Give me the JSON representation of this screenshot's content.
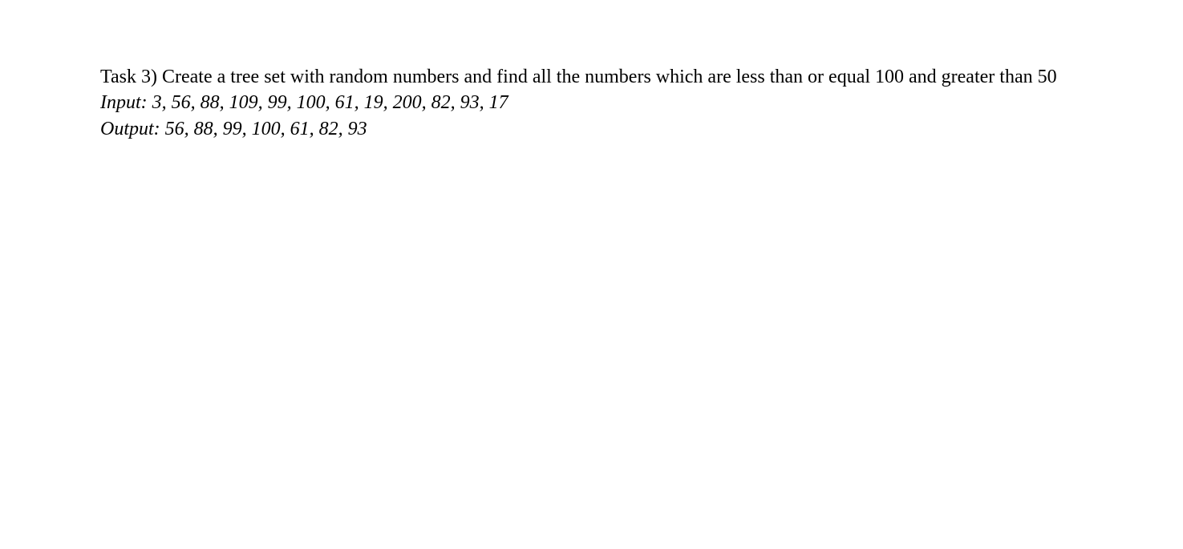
{
  "task": {
    "description": "Task 3) Create a tree set with random numbers and find all the numbers which are less than or equal 100 and greater than 50",
    "input_label": "Input:",
    "input_values": "3, 56, 88, 109, 99, 100, 61, 19, 200, 82, 93, 17",
    "output_label": "Output:",
    "output_values": "56, 88, 99, 100, 61, 82, 93"
  }
}
